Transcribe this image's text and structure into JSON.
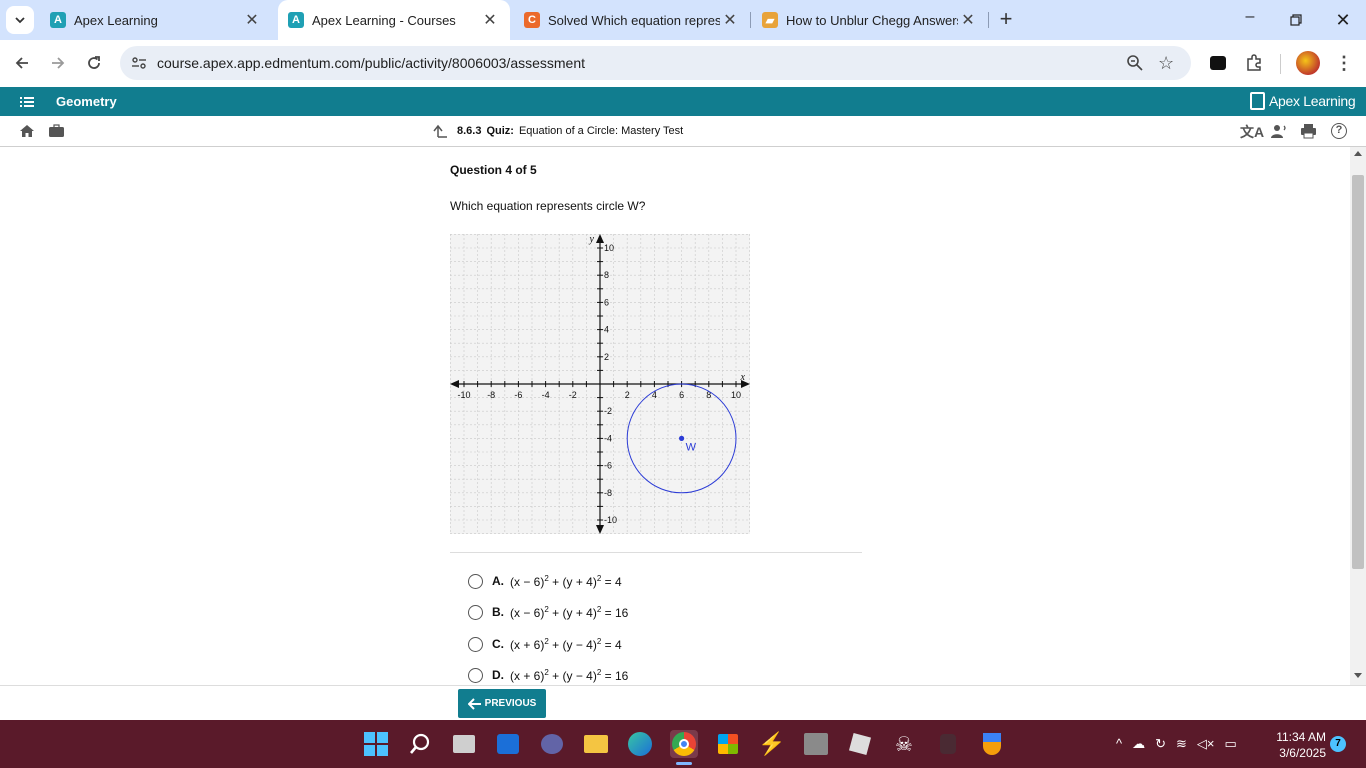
{
  "browser": {
    "tabs": [
      {
        "title": "Apex Learning",
        "active": false
      },
      {
        "title": "Apex Learning - Courses",
        "active": true
      },
      {
        "title": "Solved Which equation represe",
        "active": false
      },
      {
        "title": "How to Unblur Chegg Answers",
        "active": false
      }
    ],
    "url": "course.apex.app.edmentum.com/public/activity/8006003/assessment"
  },
  "app": {
    "course": "Geometry",
    "brand": "Apex Learning",
    "activity_number": "8.6.3",
    "activity_type": "Quiz:",
    "activity_title": "Equation of a Circle: Mastery Test"
  },
  "question": {
    "header": "Question 4 of 5",
    "prompt": "Which equation represents circle W?",
    "graph": {
      "x_label": "x",
      "y_label": "y",
      "x_ticks": [
        "-10",
        "-8",
        "-6",
        "-4",
        "-2",
        "2",
        "4",
        "6",
        "8",
        "10"
      ],
      "y_ticks": [
        "10",
        "8",
        "6",
        "4",
        "2",
        "-2",
        "-4",
        "-6",
        "-8",
        "-10"
      ],
      "circle": {
        "center_x": 6,
        "center_y": -4,
        "radius": 4,
        "label": "W"
      }
    },
    "options": [
      {
        "letter": "A.",
        "h": "6",
        "hop": "−",
        "k": "4",
        "kop": "+",
        "r2": "4"
      },
      {
        "letter": "B.",
        "h": "6",
        "hop": "−",
        "k": "4",
        "kop": "+",
        "r2": "16"
      },
      {
        "letter": "C.",
        "h": "6",
        "hop": "+",
        "k": "4",
        "kop": "−",
        "r2": "4"
      },
      {
        "letter": "D.",
        "h": "6",
        "hop": "+",
        "k": "4",
        "kop": "−",
        "r2": "16"
      }
    ]
  },
  "nav": {
    "previous": "PREVIOUS"
  },
  "taskbar": {
    "time": "11:34 AM",
    "date": "3/6/2025",
    "badge": "7"
  },
  "colors": {
    "teal": "#117d8f",
    "circle": "#2b3bd6",
    "tabstrip": "#d3e3fd",
    "taskbar": "#5a1a2a"
  }
}
